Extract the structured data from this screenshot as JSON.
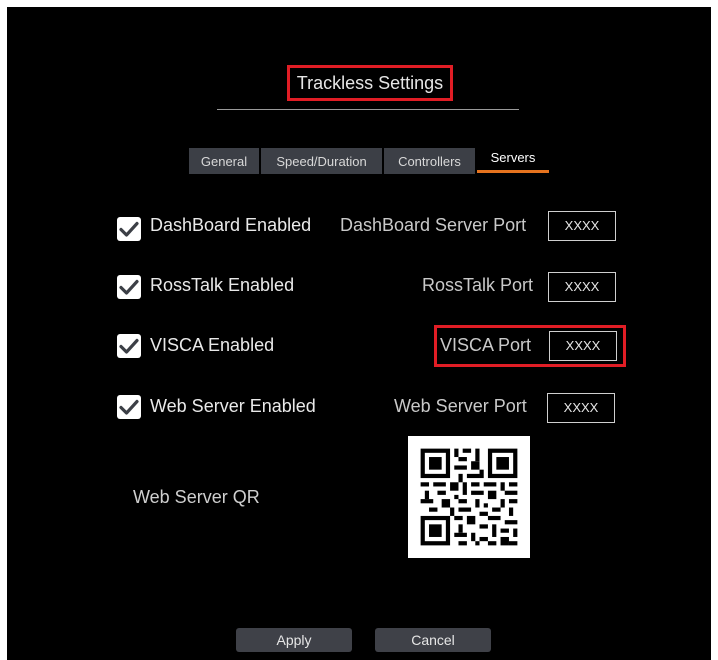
{
  "dialog": {
    "title": "Trackless Settings"
  },
  "tabs": [
    {
      "label": "General",
      "active": false
    },
    {
      "label": "Speed/Duration",
      "active": false
    },
    {
      "label": "Controllers",
      "active": false
    },
    {
      "label": "Servers",
      "active": true
    }
  ],
  "servers": [
    {
      "enabled_label": "DashBoard Enabled",
      "checked": true,
      "port_label": "DashBoard Server Port",
      "port_value": "XXXX"
    },
    {
      "enabled_label": "RossTalk Enabled",
      "checked": true,
      "port_label": "RossTalk Port",
      "port_value": "XXXX"
    },
    {
      "enabled_label": "VISCA Enabled",
      "checked": true,
      "port_label": "VISCA Port",
      "port_value": "XXXX"
    },
    {
      "enabled_label": "Web Server Enabled",
      "checked": true,
      "port_label": "Web Server Port",
      "port_value": "XXXX"
    }
  ],
  "qr": {
    "label": "Web Server QR"
  },
  "buttons": {
    "apply": "Apply",
    "cancel": "Cancel"
  },
  "colors": {
    "background": "#000000",
    "tab_bg": "#3c3f46",
    "active_tab_underline": "#e6731e",
    "highlight": "#e11d25",
    "button_bg": "#3f4148"
  }
}
